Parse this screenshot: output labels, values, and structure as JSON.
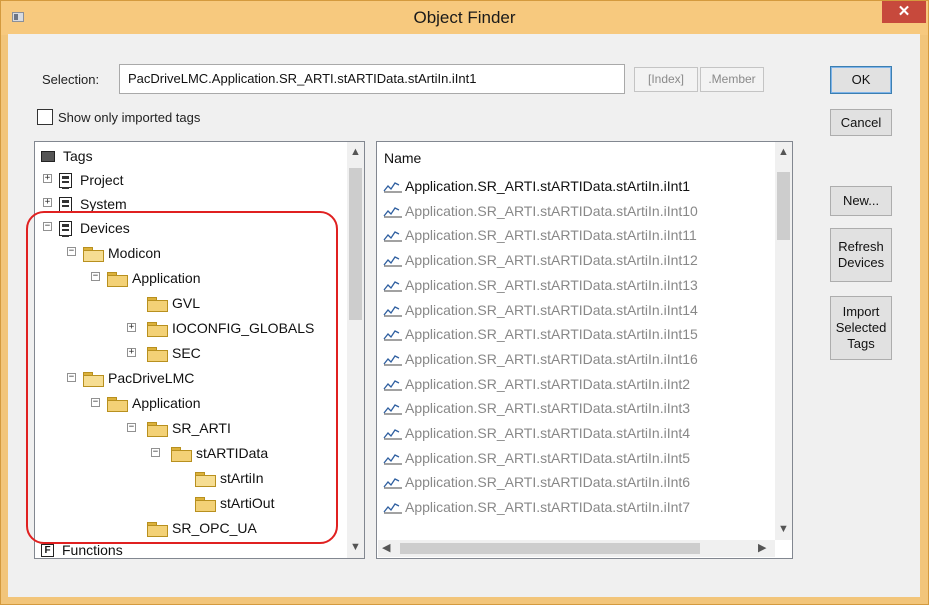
{
  "window": {
    "title": "Object Finder",
    "close_glyph": "✕"
  },
  "selection": {
    "label": "Selection:",
    "value": "PacDriveLMC.Application.SR_ARTI.stARTIData.stArtiIn.iInt1",
    "index_button": "[Index]",
    "member_button": ".Member"
  },
  "buttons": {
    "ok": "OK",
    "cancel": "Cancel",
    "new": "New...",
    "refresh_line1": "Refresh",
    "refresh_line2": "Devices",
    "import_line1": "Import",
    "import_line2": "Selected",
    "import_line3": "Tags"
  },
  "show_imported": {
    "label": "Show only imported tags",
    "checked": false
  },
  "tree": {
    "tags": "Tags",
    "project": "Project",
    "system": "System",
    "devices": "Devices",
    "modicon": "Modicon",
    "modicon_app": "Application",
    "gvl": "GVL",
    "ioconfig": "IOCONFIG_GLOBALS",
    "sec": "SEC",
    "pacdrive": "PacDriveLMC",
    "pacdrive_app": "Application",
    "sr_arti": "SR_ARTI",
    "startidata": "stARTIData",
    "startiin": "stArtiIn",
    "startiout": "stArtiOut",
    "sr_opc": "SR_OPC_UA",
    "functions": "Functions"
  },
  "list": {
    "header": "Name",
    "rows": [
      "Application.SR_ARTI.stARTIData.stArtiIn.iInt1",
      "Application.SR_ARTI.stARTIData.stArtiIn.iInt10",
      "Application.SR_ARTI.stARTIData.stArtiIn.iInt11",
      "Application.SR_ARTI.stARTIData.stArtiIn.iInt12",
      "Application.SR_ARTI.stARTIData.stArtiIn.iInt13",
      "Application.SR_ARTI.stARTIData.stArtiIn.iInt14",
      "Application.SR_ARTI.stARTIData.stArtiIn.iInt15",
      "Application.SR_ARTI.stARTIData.stArtiIn.iInt16",
      "Application.SR_ARTI.stARTIData.stArtiIn.iInt2",
      "Application.SR_ARTI.stARTIData.stArtiIn.iInt3",
      "Application.SR_ARTI.stARTIData.stArtiIn.iInt4",
      "Application.SR_ARTI.stARTIData.stArtiIn.iInt5",
      "Application.SR_ARTI.stARTIData.stArtiIn.iInt6",
      "Application.SR_ARTI.stARTIData.stArtiIn.iInt7"
    ]
  },
  "colors": {
    "title_bar": "#f7c97e",
    "close_button": "#c7493c",
    "highlight_outline": "#e02020"
  }
}
